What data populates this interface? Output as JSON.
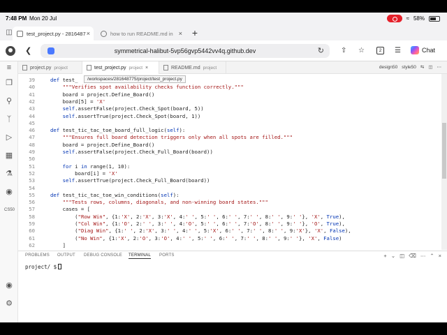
{
  "status": {
    "time": "7:48 PM",
    "date": "Mon 20 Jul",
    "battery": "58%"
  },
  "browser": {
    "tabs": [
      {
        "title": "test_project.py - 2816487"
      },
      {
        "title": "how to run README.md in"
      }
    ],
    "url": "symmetrical-halibut-5vp56gvp5442vv4q.github.dev",
    "tab_count": "2",
    "chat_label": "Chat"
  },
  "editor": {
    "tabs": [
      {
        "name": "project.py",
        "sub": "project"
      },
      {
        "name": "test_project.py",
        "sub": "project"
      },
      {
        "name": "README.md",
        "sub": "project"
      }
    ],
    "tab_right": [
      "design50",
      "style50"
    ],
    "tooltip": "/workspaces/281648775/project/test_project.py"
  },
  "code_lines": [
    {
      "n": "39",
      "t": "def test_"
    },
    {
      "n": "40",
      "t": "    \"\"\"Verifies spot availability checks function correctly.\"\"\""
    },
    {
      "n": "41",
      "t": "    board = project.Define_Board()"
    },
    {
      "n": "42",
      "t": "    board[5] = 'X'"
    },
    {
      "n": "43",
      "t": "    self.assertFalse(project.Check_Spot(board, 5))"
    },
    {
      "n": "44",
      "t": "    self.assertTrue(project.Check_Spot(board, 1))"
    },
    {
      "n": "45",
      "t": ""
    },
    {
      "n": "46",
      "t": "def test_tic_tac_toe_board_full_logic(self):"
    },
    {
      "n": "47",
      "t": "    \"\"\"Ensures full board detection triggers only when all spots are filled.\"\"\""
    },
    {
      "n": "48",
      "t": "    board = project.Define_Board()"
    },
    {
      "n": "49",
      "t": "    self.assertFalse(project.Check_Full_Board(board))"
    },
    {
      "n": "50",
      "t": ""
    },
    {
      "n": "51",
      "t": "    for i in range(1, 10):"
    },
    {
      "n": "52",
      "t": "        board[i] = 'X'"
    },
    {
      "n": "53",
      "t": "    self.assertTrue(project.Check_Full_Board(board))"
    },
    {
      "n": "54",
      "t": ""
    },
    {
      "n": "55",
      "t": "def test_tic_tac_toe_win_conditions(self):"
    },
    {
      "n": "56",
      "t": "    \"\"\"Tests rows, columns, diagonals, and non-winning board states.\"\"\""
    },
    {
      "n": "57",
      "t": "    cases = ["
    },
    {
      "n": "58",
      "t": "        (\"Row Win\", {1:'X', 2:'X', 3:'X', 4:' ', 5:' ', 6:' ', 7:' ', 8:' ', 9:' '}, 'X', True),"
    },
    {
      "n": "59",
      "t": "        (\"Col Win\", {1:'O', 2:' ', 3:' ', 4:'O', 5:' ', 6:' ', 7:'O', 8:' ', 9:' '}, 'O', True),"
    },
    {
      "n": "60",
      "t": "        (\"Diag Win\", {1:' ', 2:'X', 3:' ', 4:' ', 5:'X', 6:' ', 7:' ', 8:' ', 9:'X'}, 'X', False),"
    },
    {
      "n": "61",
      "t": "        (\"No Win\", {1:'X', 2:'O', 3:'O', 4:' ', 5:' ', 6:' ', 7:' ', 8:' ', 9:' '}, 'X', False)"
    },
    {
      "n": "62",
      "t": "    ]"
    }
  ],
  "panel": {
    "tabs": [
      "PROBLEMS",
      "OUTPUT",
      "DEBUG CONSOLE",
      "TERMINAL",
      "PORTS"
    ],
    "prompt": "project/ $"
  },
  "activity": {
    "cs50_label": "CS50"
  }
}
